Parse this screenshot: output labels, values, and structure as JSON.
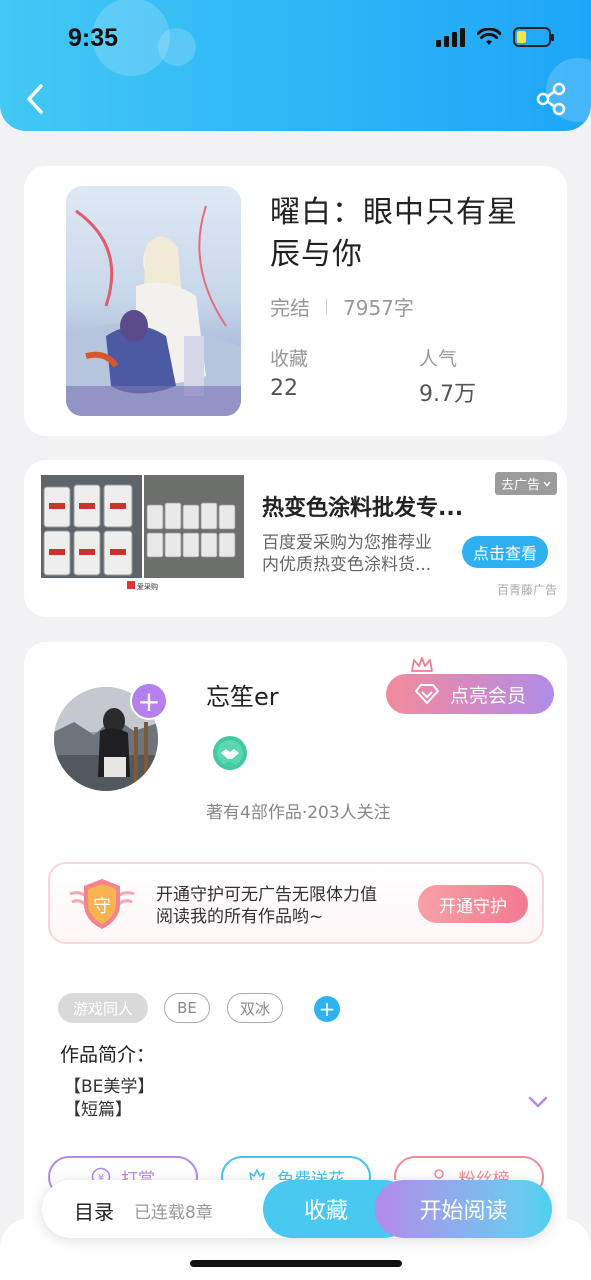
{
  "status_bar": {
    "time": "9:35"
  },
  "book": {
    "title": "曜白：眼中只有星辰与你",
    "status": "完结",
    "word_count": "7957字",
    "stats": [
      {
        "label": "收藏",
        "value": "22"
      },
      {
        "label": "人气",
        "value": "9.7万"
      }
    ]
  },
  "ad": {
    "title": "热变色涂料批发专...",
    "description": "百度爱采购为您推荐业内优质热变色涂料货...",
    "close_label": "去广告",
    "cta": "点击查看",
    "source": "百青藤广告",
    "image_watermark": "爱采购"
  },
  "author": {
    "name": "忘笙er",
    "vip_label": "点亮会员",
    "stats": "著有4部作品·203人关注",
    "guard": {
      "text_line1": "开通守护可无广告无限体力值",
      "text_line2": "阅读我的所有作品哟~",
      "button": "开通守护",
      "icon_char": "守"
    },
    "tags": [
      "游戏同人",
      "BE",
      "双冰"
    ],
    "intro_label": "作品简介：",
    "intro_lines": [
      "【BE美学】",
      "【短篇】"
    ],
    "actions": [
      {
        "label": "打赏",
        "color": "#b58ae8"
      },
      {
        "label": "免费送花",
        "color": "#46c4ee"
      },
      {
        "label": "粉丝榜",
        "color": "#f18c98"
      }
    ]
  },
  "bottom_bar": {
    "toc_label": "目录",
    "chapter_info": "已连载8章",
    "favorite_label": "收藏",
    "read_label": "开始阅读"
  },
  "colors": {
    "header_gradient_start": "#43c8f4",
    "header_gradient_end": "#1ea6f8",
    "accent_blue": "#2fb0f3",
    "accent_purple": "#b680ec",
    "vip_pink": "#f48a9b"
  }
}
